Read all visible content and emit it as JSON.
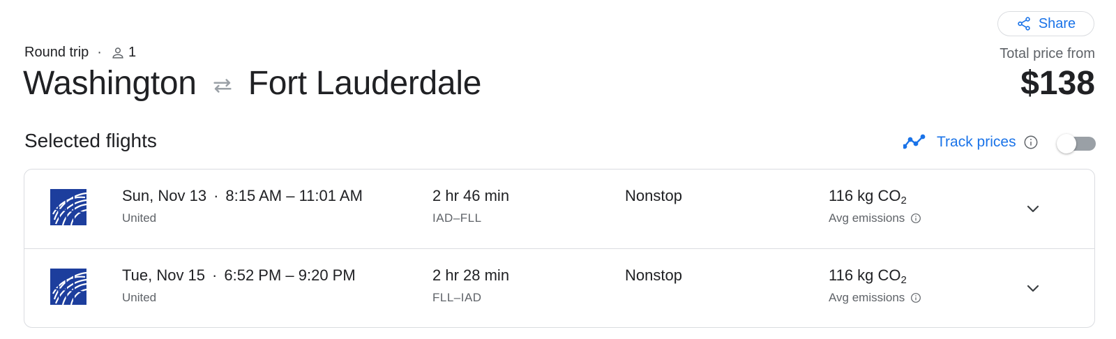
{
  "header": {
    "share_label": "Share",
    "trip_type": "Round trip",
    "separator": "·",
    "passengers": "1",
    "origin": "Washington",
    "destination": "Fort Lauderdale",
    "price_label": "Total price from",
    "price": "$138"
  },
  "selected": {
    "title": "Selected flights",
    "track_label": "Track prices",
    "track_enabled": false
  },
  "flights": [
    {
      "date": "Sun, Nov 13",
      "separator": "·",
      "times": "8:15 AM – 11:01 AM",
      "airline": "United",
      "duration": "2 hr 46 min",
      "airports": "IAD–FLL",
      "stops": "Nonstop",
      "emissions_value": "116 kg CO",
      "emissions_sub": "2",
      "emissions_label": "Avg emissions"
    },
    {
      "date": "Tue, Nov 15",
      "separator": "·",
      "times": "6:52 PM – 9:20 PM",
      "airline": "United",
      "duration": "2 hr 28 min",
      "airports": "FLL–IAD",
      "stops": "Nonstop",
      "emissions_value": "116 kg CO",
      "emissions_sub": "2",
      "emissions_label": "Avg emissions"
    }
  ],
  "colors": {
    "accent": "#1a73e8",
    "text_primary": "#202124",
    "text_secondary": "#5f6368",
    "border": "#dadce0",
    "united_blue": "#1d3e9d"
  },
  "icons": {
    "share": "share-icon",
    "person": "person-icon",
    "swap": "swap-arrows-icon",
    "trend": "trend-line-icon",
    "info": "info-icon",
    "expand": "chevron-down-icon",
    "logo": "united-globe-logo"
  }
}
